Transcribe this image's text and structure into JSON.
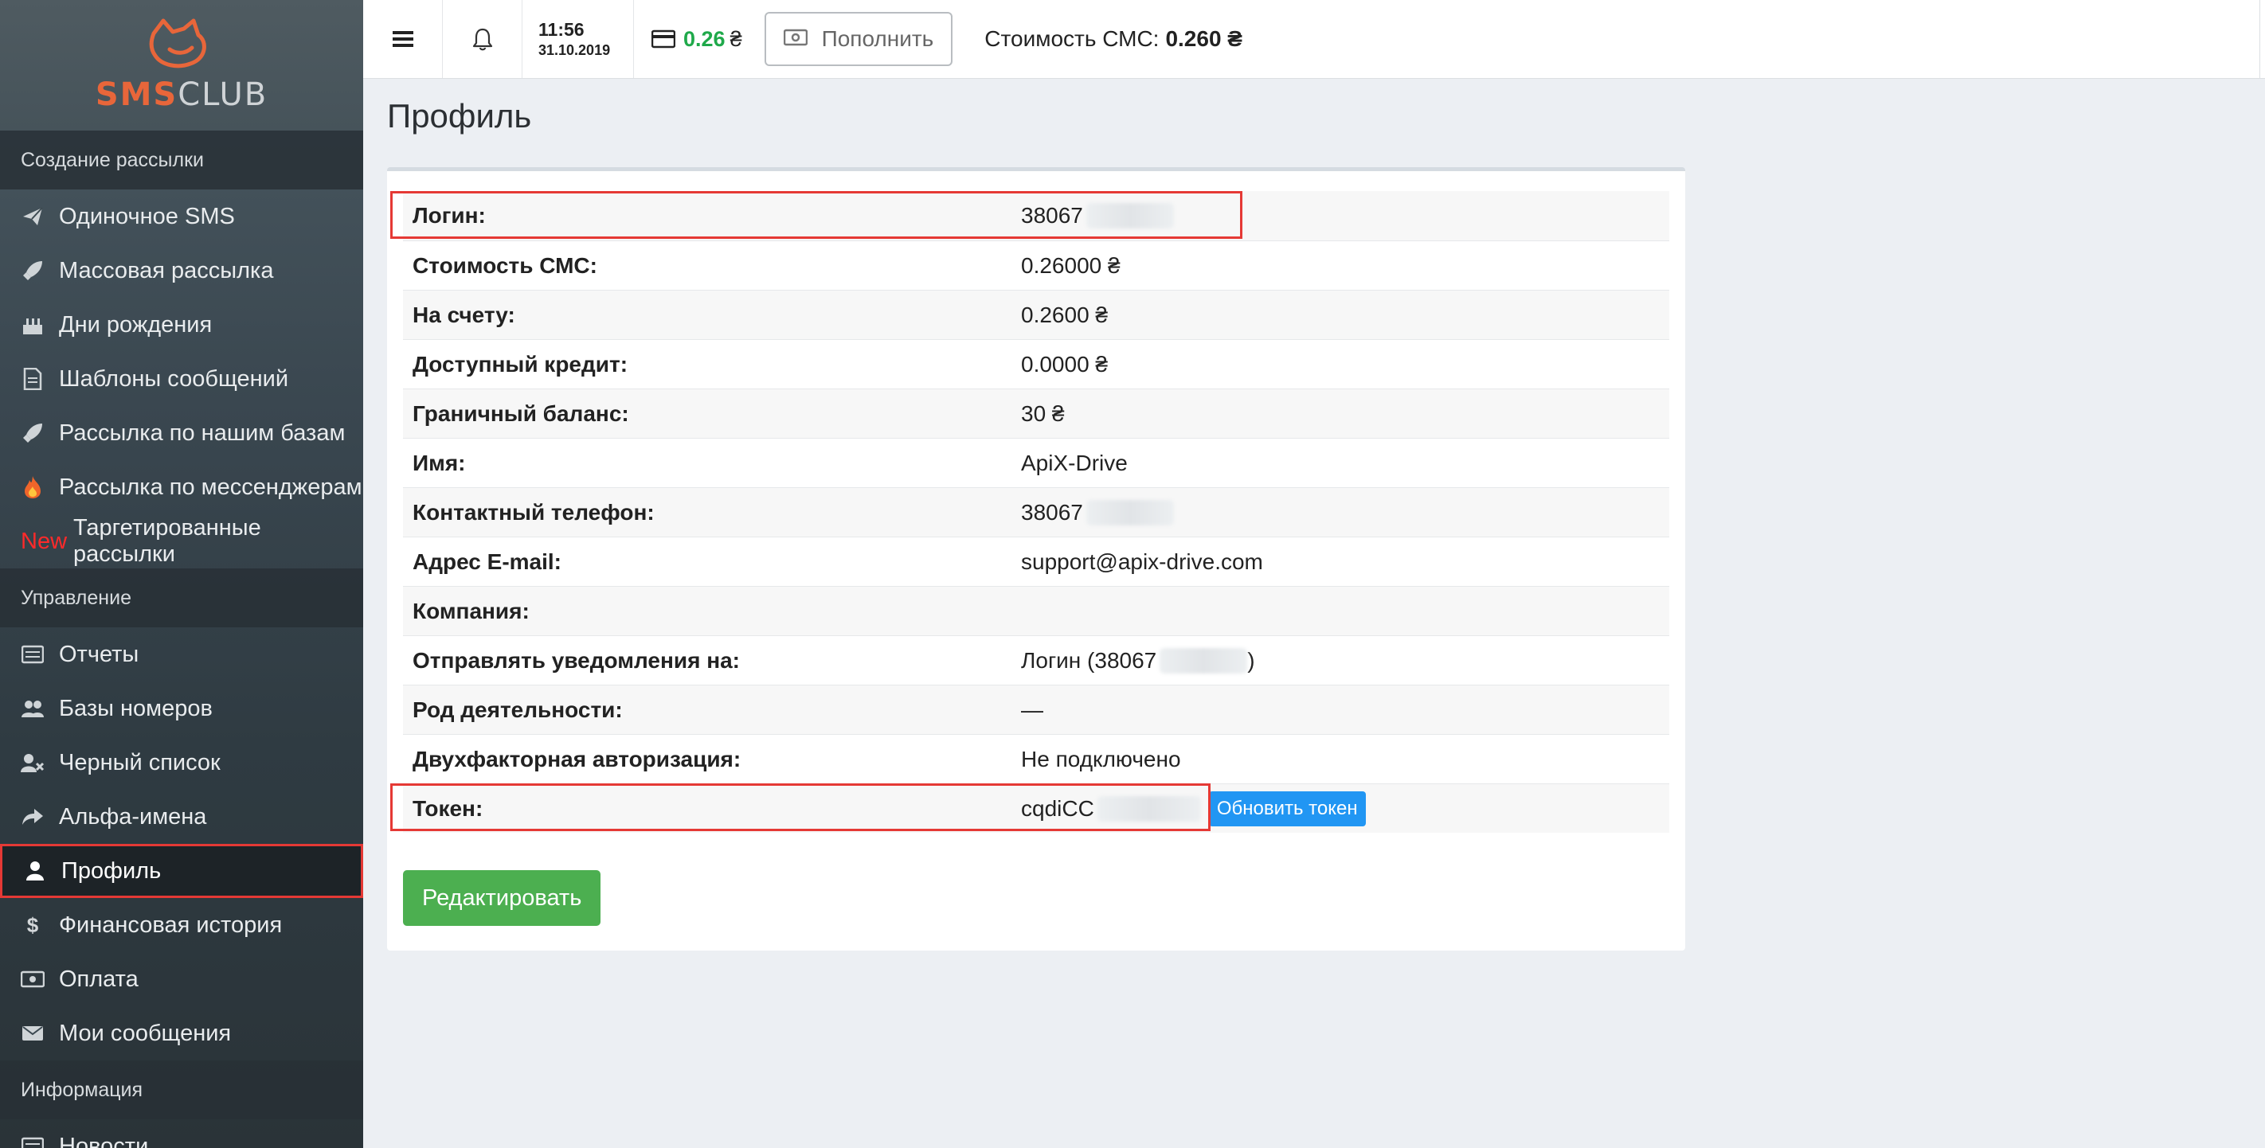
{
  "logo": {
    "part1": "SMS",
    "part2": "CLUB"
  },
  "topbar": {
    "time": "11:56",
    "date": "31.10.2019",
    "balance": "0.26",
    "currency": "₴",
    "topup_label": "Пополнить",
    "cost_label": "Стоимость СМС:",
    "cost_value": "0.260 ₴"
  },
  "sidebar": {
    "sections": [
      {
        "title": "Создание рассылки"
      },
      {
        "title": "Управление"
      },
      {
        "title": "Информация"
      }
    ],
    "create": [
      {
        "label": "Одиночное SMS",
        "icon": "paper-plane-icon"
      },
      {
        "label": "Массовая рассылка",
        "icon": "rocket-icon"
      },
      {
        "label": "Дни рождения",
        "icon": "cake-icon"
      },
      {
        "label": "Шаблоны сообщений",
        "icon": "document-icon"
      },
      {
        "label": "Рассылка по нашим базам",
        "icon": "rocket-icon"
      },
      {
        "label": "Рассылка по мессенджерам",
        "icon": "fire-icon"
      },
      {
        "badge": "New",
        "label": "Таргетированные рассылки"
      }
    ],
    "manage": [
      {
        "label": "Отчеты",
        "icon": "list-icon"
      },
      {
        "label": "Базы номеров",
        "icon": "users-icon"
      },
      {
        "label": "Черный список",
        "icon": "user-block-icon"
      },
      {
        "label": "Альфа-имена",
        "icon": "share-icon"
      },
      {
        "label": "Профиль",
        "icon": "user-icon"
      },
      {
        "label": "Финансовая история",
        "icon": "dollar-icon"
      },
      {
        "label": "Оплата",
        "icon": "money-icon"
      },
      {
        "label": "Мои сообщения",
        "icon": "envelope-icon"
      }
    ],
    "info": [
      {
        "label": "Новости",
        "icon": "news-icon"
      }
    ]
  },
  "page": {
    "title": "Профиль"
  },
  "profile": {
    "rows": [
      {
        "label": "Логин:",
        "value": "38067"
      },
      {
        "label": "Стоимость СМС:",
        "value": "0.26000 ₴"
      },
      {
        "label": "На счету:",
        "value": "0.2600 ₴"
      },
      {
        "label": "Доступный кредит:",
        "value": "0.0000 ₴"
      },
      {
        "label": "Граничный баланс:",
        "value": "30 ₴"
      },
      {
        "label": "Имя:",
        "value": "ApiX-Drive"
      },
      {
        "label": "Контактный телефон:",
        "value": "38067"
      },
      {
        "label": "Адрес E-mail:",
        "value": "support@apix-drive.com"
      },
      {
        "label": "Компания:",
        "value": ""
      },
      {
        "label": "Отправлять уведомления на:",
        "value": "Логин (38067",
        "suffix": ")"
      },
      {
        "label": "Род деятельности:",
        "value": "—"
      },
      {
        "label": "Двухфакторная авторизация:",
        "value": "Не подключено"
      },
      {
        "label": "Токен:",
        "value": "cqdiCC"
      }
    ],
    "refresh_token_label": "Обновить токен",
    "edit_label": "Редактировать"
  }
}
